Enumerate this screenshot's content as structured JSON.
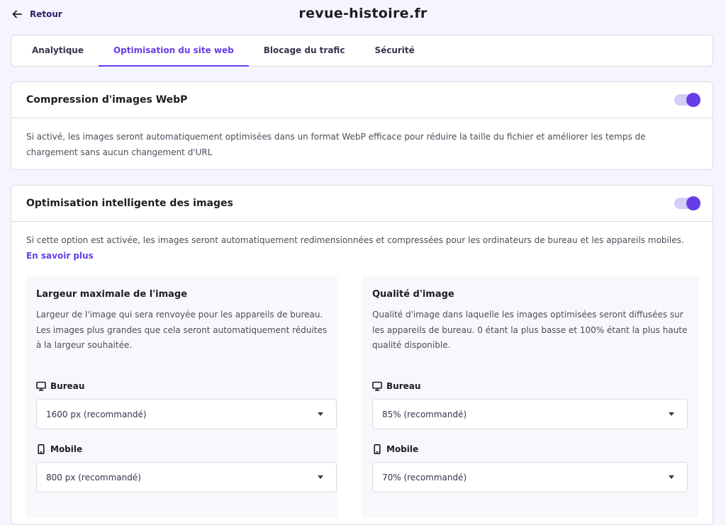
{
  "header": {
    "back_label": "Retour",
    "site_title": "revue-histoire.fr"
  },
  "tabs": [
    {
      "label": "Analytique",
      "active": false
    },
    {
      "label": "Optimisation du site web",
      "active": true
    },
    {
      "label": "Blocage du trafic",
      "active": false
    },
    {
      "label": "Sécurité",
      "active": false
    }
  ],
  "webp": {
    "title": "Compression d'images WebP",
    "enabled": true,
    "description": "Si activé, les images seront automatiquement optimisées dans un format WebP efficace pour réduire la taille du fichier et améliorer les temps de chargement sans aucun changement d'URL"
  },
  "smart": {
    "title": "Optimisation intelligente des images",
    "enabled": true,
    "description": "Si cette option est activée, les images seront automatiquement redimensionnées et compressées pour les ordinateurs de bureau et les appareils mobiles.",
    "learn_more": "En savoir plus",
    "width_panel": {
      "title": "Largeur maximale de l'image",
      "description": "Largeur de l'image qui sera renvoyée pour les appareils de bureau. Les images plus grandes que cela seront automatiquement réduites à la largeur souhaitée.",
      "desktop_label": "Bureau",
      "desktop_value": "1600 px (recommandé)",
      "mobile_label": "Mobile",
      "mobile_value": "800 px (recommandé)"
    },
    "quality_panel": {
      "title": "Qualité d'image",
      "description": "Qualité d'image dans laquelle les images optimisées seront diffusées sur les appareils de bureau. 0 étant la plus basse et 100% étant la plus haute qualité disponible.",
      "desktop_label": "Bureau",
      "desktop_value": "85% (recommandé)",
      "mobile_label": "Mobile",
      "mobile_value": "70% (recommandé)"
    }
  },
  "colors": {
    "accent": "#673de6",
    "page_background": "#f4f5ff",
    "panel_background": "#f7f7fc"
  },
  "icons": [
    "arrow-left-icon",
    "chevron-down-icon",
    "monitor-icon",
    "mobile-phone-icon"
  ]
}
